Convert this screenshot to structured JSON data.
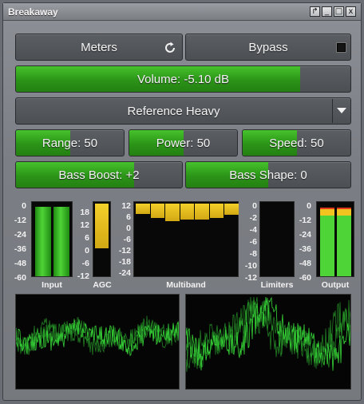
{
  "window": {
    "title": "Breakaway",
    "controls": [
      "↱",
      "_",
      "□",
      "x"
    ]
  },
  "meters_button": {
    "label": "Meters",
    "icon": "refresh-icon"
  },
  "bypass_button": {
    "label": "Bypass",
    "icon": "square-icon"
  },
  "volume": {
    "label": "Volume: -5.10 dB",
    "level": 0.85
  },
  "preset": {
    "label": "Reference Heavy",
    "icon": "dropdown-arrow-icon"
  },
  "sliders": [
    {
      "label": "Range: 50",
      "level": 0.5
    },
    {
      "label": "Power: 50",
      "level": 0.5
    },
    {
      "label": "Speed: 50",
      "level": 0.5
    }
  ],
  "bass_boost": {
    "label": "Bass Boost: +2",
    "level": 0.71
  },
  "bass_shape": {
    "label": "Bass Shape: 0",
    "level": 0.5
  },
  "meters": {
    "input": {
      "caption": "Input",
      "scale": [
        "0",
        "-12",
        "-24",
        "-36",
        "-48",
        "-60"
      ],
      "levels": [
        0.96,
        0.96
      ]
    },
    "agc": {
      "caption": "AGC",
      "scale": [
        "18",
        "12",
        "6",
        "0",
        "-6",
        "-12"
      ],
      "level": 0.62
    },
    "multiband": {
      "caption": "Multiband",
      "scale": [
        "12",
        "6",
        "0",
        "-6",
        "-12",
        "-18",
        "-24"
      ],
      "bands": [
        0.14,
        0.2,
        0.24,
        0.22,
        0.22,
        0.2,
        0.15
      ]
    },
    "limiters": {
      "caption": "Limiters",
      "scale": [
        "0",
        "-2",
        "-4",
        "-6",
        "-8",
        "-10",
        "-12"
      ],
      "levels": [
        0,
        0
      ]
    },
    "output": {
      "caption": "Output",
      "scale": [
        "0",
        "-12",
        "-24",
        "-36",
        "-48",
        "-60"
      ],
      "levels": [
        0.95,
        0.95
      ]
    }
  },
  "colors": {
    "green": "#2b9418",
    "yellow": "#e8c21c",
    "scope": "#39e03a"
  }
}
